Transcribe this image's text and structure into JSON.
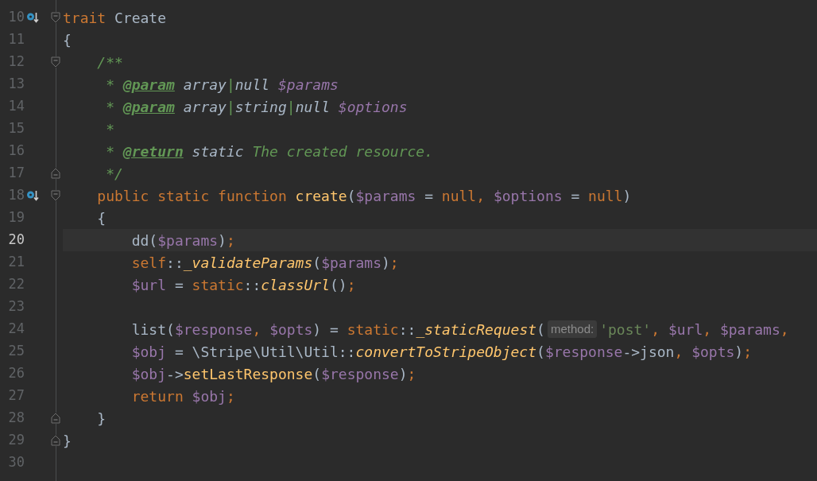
{
  "editor": {
    "lines": [
      {
        "number": "10",
        "current": false,
        "implements_marker": true,
        "fold_start": true,
        "fold_end": false,
        "tokens": [
          {
            "kind": "keyword",
            "text": "trait"
          },
          {
            "kind": "plain",
            "text": " Create"
          }
        ]
      },
      {
        "number": "11",
        "current": false,
        "implements_marker": false,
        "fold_start": false,
        "fold_end": false,
        "tokens": [
          {
            "kind": "plain",
            "text": "{"
          }
        ]
      },
      {
        "number": "12",
        "current": false,
        "implements_marker": false,
        "fold_start": true,
        "fold_end": false,
        "tokens": [
          {
            "kind": "comment",
            "text": "    /**"
          }
        ]
      },
      {
        "number": "13",
        "current": false,
        "implements_marker": false,
        "fold_start": false,
        "fold_end": false,
        "tokens": [
          {
            "kind": "comment",
            "text": "     * "
          },
          {
            "kind": "doctag",
            "text": "@param"
          },
          {
            "kind": "doctype",
            "text": " array"
          },
          {
            "kind": "comment",
            "text": "|"
          },
          {
            "kind": "doctype",
            "text": "null"
          },
          {
            "kind": "docvar",
            "text": " $params"
          }
        ]
      },
      {
        "number": "14",
        "current": false,
        "implements_marker": false,
        "fold_start": false,
        "fold_end": false,
        "tokens": [
          {
            "kind": "comment",
            "text": "     * "
          },
          {
            "kind": "doctag",
            "text": "@param"
          },
          {
            "kind": "doctype",
            "text": " array"
          },
          {
            "kind": "comment",
            "text": "|"
          },
          {
            "kind": "doctype",
            "text": "string"
          },
          {
            "kind": "comment",
            "text": "|"
          },
          {
            "kind": "doctype",
            "text": "null"
          },
          {
            "kind": "docvar",
            "text": " $options"
          }
        ]
      },
      {
        "number": "15",
        "current": false,
        "implements_marker": false,
        "fold_start": false,
        "fold_end": false,
        "tokens": [
          {
            "kind": "comment",
            "text": "     *"
          }
        ]
      },
      {
        "number": "16",
        "current": false,
        "implements_marker": false,
        "fold_start": false,
        "fold_end": false,
        "tokens": [
          {
            "kind": "comment",
            "text": "     * "
          },
          {
            "kind": "doctag",
            "text": "@return"
          },
          {
            "kind": "doctype",
            "text": " static"
          },
          {
            "kind": "comment",
            "text": " The created resource."
          }
        ]
      },
      {
        "number": "17",
        "current": false,
        "implements_marker": false,
        "fold_start": false,
        "fold_end": true,
        "tokens": [
          {
            "kind": "comment",
            "text": "     */"
          }
        ]
      },
      {
        "number": "18",
        "current": false,
        "implements_marker": true,
        "fold_start": true,
        "fold_end": false,
        "tokens": [
          {
            "kind": "keyword",
            "text": "    public static function "
          },
          {
            "kind": "function",
            "text": "create"
          },
          {
            "kind": "plain",
            "text": "("
          },
          {
            "kind": "variable",
            "text": "$params"
          },
          {
            "kind": "plain",
            "text": " = "
          },
          {
            "kind": "keyword",
            "text": "null, "
          },
          {
            "kind": "variable",
            "text": "$options"
          },
          {
            "kind": "plain",
            "text": " = "
          },
          {
            "kind": "keyword",
            "text": "null"
          },
          {
            "kind": "plain",
            "text": ")"
          }
        ]
      },
      {
        "number": "19",
        "current": false,
        "implements_marker": false,
        "fold_start": false,
        "fold_end": false,
        "tokens": [
          {
            "kind": "plain",
            "text": "    {"
          }
        ]
      },
      {
        "number": "20",
        "current": true,
        "implements_marker": false,
        "fold_start": false,
        "fold_end": false,
        "tokens": [
          {
            "kind": "plain",
            "text": "        dd("
          },
          {
            "kind": "variable",
            "text": "$params"
          },
          {
            "kind": "plain",
            "text": ")"
          },
          {
            "kind": "keyword",
            "text": ";"
          }
        ]
      },
      {
        "number": "21",
        "current": false,
        "implements_marker": false,
        "fold_start": false,
        "fold_end": false,
        "tokens": [
          {
            "kind": "keyword",
            "text": "        self"
          },
          {
            "kind": "plain",
            "text": "::"
          },
          {
            "kind": "static_call",
            "text": "_validateParams"
          },
          {
            "kind": "plain",
            "text": "("
          },
          {
            "kind": "variable",
            "text": "$params"
          },
          {
            "kind": "plain",
            "text": ")"
          },
          {
            "kind": "keyword",
            "text": ";"
          }
        ]
      },
      {
        "number": "22",
        "current": false,
        "implements_marker": false,
        "fold_start": false,
        "fold_end": false,
        "tokens": [
          {
            "kind": "variable",
            "text": "        $url"
          },
          {
            "kind": "plain",
            "text": " = "
          },
          {
            "kind": "keyword",
            "text": "static"
          },
          {
            "kind": "plain",
            "text": "::"
          },
          {
            "kind": "static_call",
            "text": "classUrl"
          },
          {
            "kind": "plain",
            "text": "()"
          },
          {
            "kind": "keyword",
            "text": ";"
          }
        ]
      },
      {
        "number": "23",
        "current": false,
        "implements_marker": false,
        "fold_start": false,
        "fold_end": false
      },
      {
        "number": "24",
        "current": false,
        "implements_marker": false,
        "fold_start": false,
        "fold_end": false,
        "tokens": [
          {
            "kind": "plain",
            "text": "        list("
          },
          {
            "kind": "variable",
            "text": "$response"
          },
          {
            "kind": "keyword",
            "text": ", "
          },
          {
            "kind": "variable",
            "text": "$opts"
          },
          {
            "kind": "plain",
            "text": ") = "
          },
          {
            "kind": "keyword",
            "text": "static"
          },
          {
            "kind": "plain",
            "text": "::"
          },
          {
            "kind": "static_call",
            "text": "_staticRequest"
          },
          {
            "kind": "plain",
            "text": "("
          },
          {
            "kind": "hint",
            "text": "method:"
          },
          {
            "kind": "string",
            "text": "'post'"
          },
          {
            "kind": "keyword",
            "text": ", "
          },
          {
            "kind": "variable",
            "text": "$url"
          },
          {
            "kind": "keyword",
            "text": ", "
          },
          {
            "kind": "variable",
            "text": "$params"
          },
          {
            "kind": "keyword",
            "text": ","
          }
        ]
      },
      {
        "number": "25",
        "current": false,
        "implements_marker": false,
        "fold_start": false,
        "fold_end": false,
        "tokens": [
          {
            "kind": "variable",
            "text": "        $obj"
          },
          {
            "kind": "plain",
            "text": " = \\Stripe\\Util\\Util::"
          },
          {
            "kind": "static_call",
            "text": "convertToStripeObject"
          },
          {
            "kind": "plain",
            "text": "("
          },
          {
            "kind": "variable",
            "text": "$response"
          },
          {
            "kind": "plain",
            "text": "->json"
          },
          {
            "kind": "keyword",
            "text": ", "
          },
          {
            "kind": "variable",
            "text": "$opts"
          },
          {
            "kind": "plain",
            "text": ")"
          },
          {
            "kind": "keyword",
            "text": ";"
          }
        ]
      },
      {
        "number": "26",
        "current": false,
        "implements_marker": false,
        "fold_start": false,
        "fold_end": false,
        "tokens": [
          {
            "kind": "variable",
            "text": "        $obj"
          },
          {
            "kind": "plain",
            "text": "->"
          },
          {
            "kind": "method",
            "text": "setLastResponse"
          },
          {
            "kind": "plain",
            "text": "("
          },
          {
            "kind": "variable",
            "text": "$response"
          },
          {
            "kind": "plain",
            "text": ")"
          },
          {
            "kind": "keyword",
            "text": ";"
          }
        ]
      },
      {
        "number": "27",
        "current": false,
        "implements_marker": false,
        "fold_start": false,
        "fold_end": false,
        "tokens": [
          {
            "kind": "keyword",
            "text": "        return "
          },
          {
            "kind": "variable",
            "text": "$obj"
          },
          {
            "kind": "keyword",
            "text": ";"
          }
        ]
      },
      {
        "number": "28",
        "current": false,
        "implements_marker": false,
        "fold_start": false,
        "fold_end": true,
        "tokens": [
          {
            "kind": "plain",
            "text": "    }"
          }
        ]
      },
      {
        "number": "29",
        "current": false,
        "implements_marker": false,
        "fold_start": false,
        "fold_end": true,
        "tokens": [
          {
            "kind": "plain",
            "text": "}"
          }
        ]
      },
      {
        "number": "30",
        "current": false,
        "implements_marker": false,
        "fold_start": false,
        "fold_end": false
      }
    ]
  }
}
